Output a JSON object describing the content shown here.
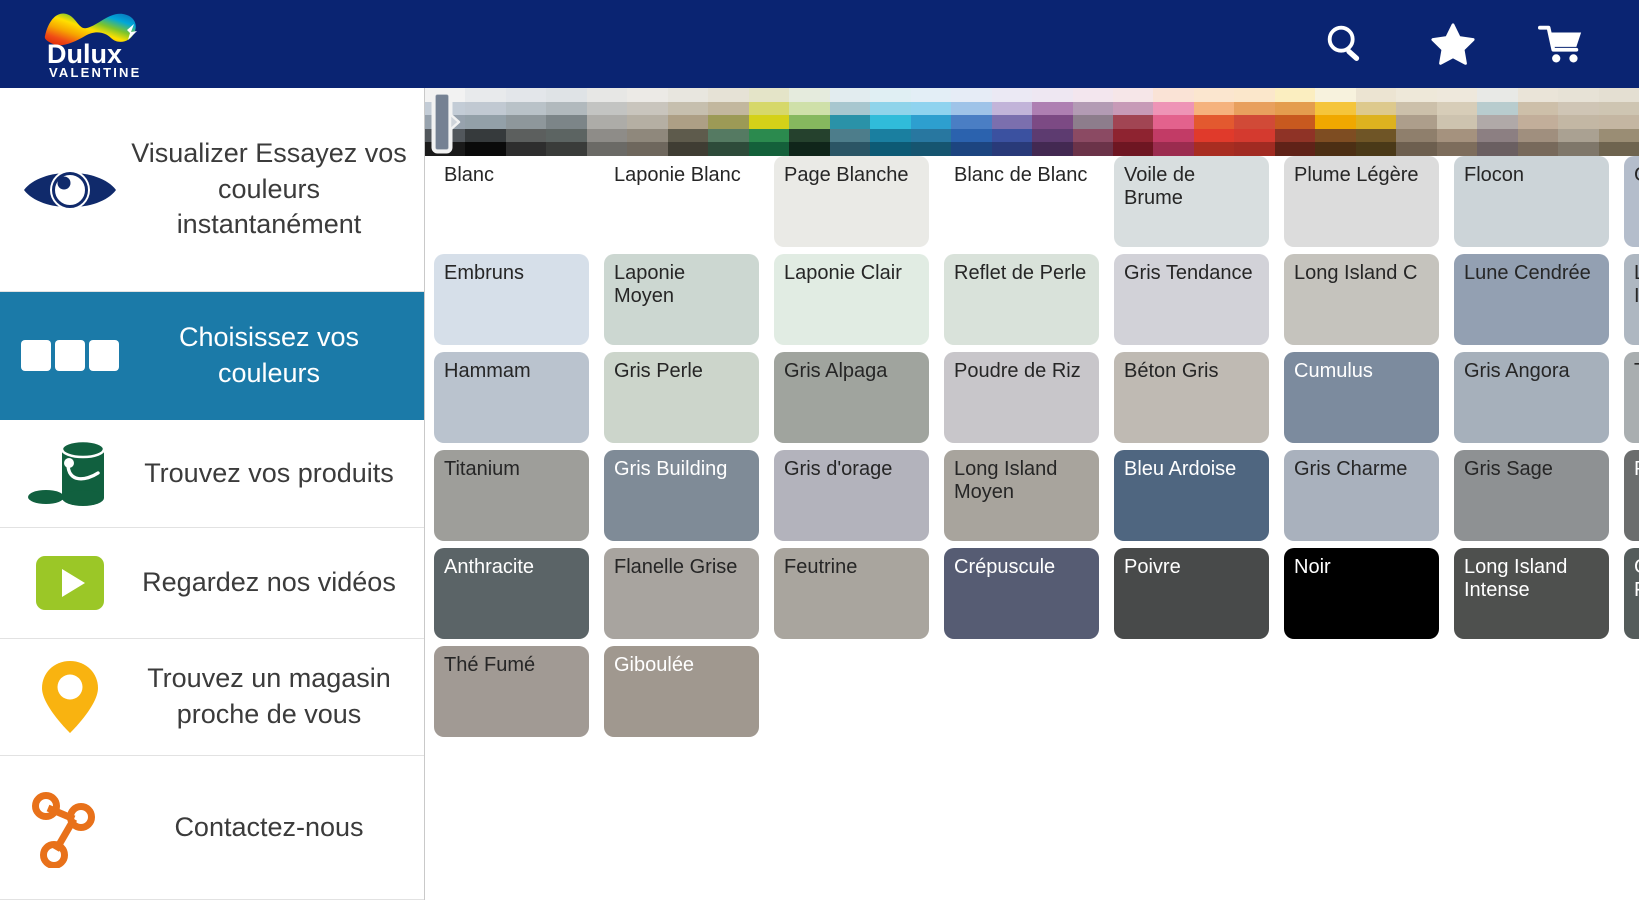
{
  "app": {
    "brand_primary": "#0a2472",
    "accent": "#1b7aa8",
    "logo_name": "Dulux",
    "logo_sub": "VALENTINE"
  },
  "topbar": {
    "icons": [
      {
        "name": "search-icon",
        "label": "Rechercher"
      },
      {
        "name": "star-icon",
        "label": "Favoris"
      },
      {
        "name": "cart-icon",
        "label": "Panier"
      }
    ]
  },
  "sidebar": {
    "items": [
      {
        "label": "Visualizer Essayez vos couleurs instantanément",
        "icon": "eye-icon",
        "active": false
      },
      {
        "label": "Choisissez vos couleurs",
        "icon": "swatches-icon",
        "active": true
      },
      {
        "label": "Trouvez vos produits",
        "icon": "paint-can-icon",
        "active": false
      },
      {
        "label": "Regardez nos vidéos",
        "icon": "play-icon",
        "active": false
      },
      {
        "label": "Trouvez un magasin proche de vous",
        "icon": "map-pin-icon",
        "active": false
      },
      {
        "label": "Contactez-nous",
        "icon": "share-network-icon",
        "active": false
      }
    ]
  },
  "palette_strip": {
    "selector_name": "palette-range-selector",
    "rows": [
      [
        "#f2f2f2",
        "#e8eaec",
        "#e3e6ea",
        "#dfe3e6",
        "#e7e7e5",
        "#eceae6",
        "#e8e6df",
        "#e6e2d6",
        "#e4e4c8",
        "#e5ebdd",
        "#e2ecef",
        "#e0eff3",
        "#e3eef6",
        "#e6ecf6",
        "#ebe9f4",
        "#eee7f2",
        "#f3e6ee",
        "#f6e6e8",
        "#fae3d6",
        "#fbe6cf",
        "#fbe7cb",
        "#fbeec0",
        "#f7f2dd",
        "#ece4d2",
        "#eee8d9",
        "#eee8dc",
        "#e8e9e6",
        "#eae4d8",
        "#e7e2d6",
        "#e4dfd2"
      ],
      [
        "#c3ccd6",
        "#c1c9d2",
        "#b9c2c8",
        "#b1b9bd",
        "#c3c4c2",
        "#c9c5bd",
        "#c6bfae",
        "#c2b79e",
        "#d6d86a",
        "#cfe0a9",
        "#a8c7cf",
        "#8fd4ea",
        "#8fd3ef",
        "#9fc3e8",
        "#c2b4d9",
        "#ae7fb2",
        "#b39bb4",
        "#c79ab7",
        "#ee94b6",
        "#f5b27d",
        "#e8a05e",
        "#e49d4e",
        "#f5c53b",
        "#ddc98d",
        "#ccc0aa",
        "#d7cdb8",
        "#b8ccce",
        "#cdbfa9",
        "#cfc5b5",
        "#cec5b2"
      ],
      [
        "#97a2ad",
        "#93a0a8",
        "#8e979b",
        "#7c8588",
        "#adaca8",
        "#b5afa3",
        "#ad9f85",
        "#9c9a56",
        "#d4d118",
        "#86b85e",
        "#2a92a8",
        "#30bcda",
        "#2d9fcf",
        "#4a7ec4",
        "#7b6fae",
        "#7c4a84",
        "#8d7d8c",
        "#a14553",
        "#e3628d",
        "#e3592f",
        "#d14a37",
        "#c8591f",
        "#f0a800",
        "#ddb21f",
        "#ad9e8b",
        "#cdc3af",
        "#b0a9a8",
        "#c2ae9a",
        "#c3b7a4",
        "#c4b6a2"
      ],
      [
        "#52575c",
        "#363a3c",
        "#5c5f5e",
        "#5c6462",
        "#8e8c88",
        "#8f887c",
        "#5e5b4c",
        "#557a62",
        "#2b8a4e",
        "#25412d",
        "#4d7d8b",
        "#1a7fa0",
        "#2877a0",
        "#2b62ae",
        "#3b51a0",
        "#5d3b70",
        "#8b4a63",
        "#8e2330",
        "#c23b66",
        "#e03a2b",
        "#d43a2f",
        "#8f3326",
        "#7e4d22",
        "#6f5526",
        "#8f7f6c",
        "#a5927e",
        "#8c7f82",
        "#a08f7e",
        "#aaa192",
        "#9a8d74"
      ],
      [
        "#1a1a1a",
        "#0a0a0a",
        "#2e2e2e",
        "#3a3c3a",
        "#6b6a66",
        "#6e675d",
        "#3f3d33",
        "#2e4b3a",
        "#14603a",
        "#10251a",
        "#2b5565",
        "#0d5a74",
        "#165570",
        "#1d4580",
        "#293a79",
        "#432952",
        "#6b3349",
        "#6e1622",
        "#9b2c4f",
        "#a82d21",
        "#a12b22",
        "#5f2218",
        "#4c2f14",
        "#4a3918",
        "#6d5f4f",
        "#7d6d5c",
        "#6a5f61",
        "#77695b",
        "#7f776a",
        "#6e644f"
      ]
    ]
  },
  "swatch_grid": {
    "rows": [
      [
        {
          "name": "Blanc",
          "hex": "#ffffff",
          "text": "dark",
          "plain": true
        },
        {
          "name": "Laponie Blanc",
          "hex": "#ffffff",
          "text": "dark",
          "plain": true
        },
        {
          "name": "Page Blanche",
          "hex": "#eaeae6",
          "text": "dark",
          "plain": false
        },
        {
          "name": "Blanc de Blanc",
          "hex": "#ffffff",
          "text": "dark",
          "plain": true
        },
        {
          "name": "Voile de Brume",
          "hex": "#d8dedf",
          "text": "dark",
          "plain": false
        },
        {
          "name": "Plume Légère",
          "hex": "#dcdcdc",
          "text": "dark",
          "plain": false
        },
        {
          "name": "Flocon",
          "hex": "#ccd4d8",
          "text": "dark",
          "plain": false
        }
      ],
      [
        {
          "name": "Galet poli",
          "hex": "#b4bdcb",
          "text": "dark",
          "plain": false
        },
        {
          "name": "Embruns",
          "hex": "#d6dfe9",
          "text": "dark",
          "plain": false
        },
        {
          "name": "Laponie Moyen",
          "hex": "#ccd7d1",
          "text": "dark",
          "plain": false
        },
        {
          "name": "Laponie Clair",
          "hex": "#e1ece3",
          "text": "dark",
          "plain": false
        },
        {
          "name": "Reflet de Perle",
          "hex": "#d9e2da",
          "text": "dark",
          "plain": false
        },
        {
          "name": "Gris Tendance",
          "hex": "#d2d2d8",
          "text": "dark",
          "plain": false
        },
        {
          "name": "Long Island C",
          "hex": "#c5c3bd",
          "text": "dark",
          "plain": false
        }
      ],
      [
        {
          "name": "Lune Cendrée",
          "hex": "#93a0b2",
          "text": "dark",
          "plain": false
        },
        {
          "name": "Laponie Intense",
          "hex": "#aeb7c1",
          "text": "dark",
          "plain": false
        },
        {
          "name": "Hammam",
          "hex": "#bac3ce",
          "text": "dark",
          "plain": false
        },
        {
          "name": "Gris Perle",
          "hex": "#ccd5cb",
          "text": "dark",
          "plain": false
        },
        {
          "name": "Gris Alpaga",
          "hex": "#a0a49e",
          "text": "dark",
          "plain": false
        },
        {
          "name": "Poudre de Riz",
          "hex": "#c8c6ca",
          "text": "dark",
          "plain": false
        },
        {
          "name": "Béton Gris",
          "hex": "#bfbab3",
          "text": "dark",
          "plain": false
        }
      ],
      [
        {
          "name": "Cumulus",
          "hex": "#7c8b9e",
          "text": "light",
          "plain": false
        },
        {
          "name": "Gris Angora",
          "hex": "#a6b0bb",
          "text": "dark",
          "plain": false
        },
        {
          "name": "Toits de Paris",
          "hex": "#a9aeb0",
          "text": "dark",
          "plain": false
        },
        {
          "name": "Titanium",
          "hex": "#9e9e9a",
          "text": "dark",
          "plain": false
        },
        {
          "name": "Gris Building",
          "hex": "#7f8b97",
          "text": "light",
          "plain": false
        },
        {
          "name": "Gris d'orage",
          "hex": "#b3b3bc",
          "text": "dark",
          "plain": false
        },
        {
          "name": "Long Island Moyen",
          "hex": "#a8a49d",
          "text": "dark",
          "plain": false
        }
      ],
      [
        {
          "name": "Bleu Ardoise",
          "hex": "#4f6680",
          "text": "light",
          "plain": false
        },
        {
          "name": "Gris Charme",
          "hex": "#a9b1bd",
          "text": "dark",
          "plain": false
        },
        {
          "name": "Gris Sage",
          "hex": "#8e9193",
          "text": "dark",
          "plain": false
        },
        {
          "name": "Pierre de Lave",
          "hex": "#6b6d6d",
          "text": "light",
          "plain": false
        },
        {
          "name": "Anthracite",
          "hex": "#5b6467",
          "text": "light",
          "plain": false
        },
        {
          "name": "Flanelle Grise",
          "hex": "#a8a49f",
          "text": "dark",
          "plain": false
        },
        {
          "name": "Feutrine",
          "hex": "#a9a59e",
          "text": "dark",
          "plain": false
        }
      ],
      [
        {
          "name": "Crépuscule",
          "hex": "#565c73",
          "text": "light",
          "plain": false
        },
        {
          "name": "Poivre",
          "hex": "#484a4a",
          "text": "light",
          "plain": false
        },
        {
          "name": "Noir",
          "hex": "#000000",
          "text": "light",
          "plain": false
        },
        {
          "name": "Long Island Intense",
          "hex": "#4e504e",
          "text": "light",
          "plain": false
        },
        {
          "name": "Gris Ferronnerie",
          "hex": "#545c5b",
          "text": "light",
          "plain": false
        },
        {
          "name": "Thé Fumé",
          "hex": "#a19a94",
          "text": "dark",
          "plain": false
        },
        {
          "name": "Giboulée",
          "hex": "#a0988f",
          "text": "light",
          "plain": false
        }
      ]
    ]
  }
}
